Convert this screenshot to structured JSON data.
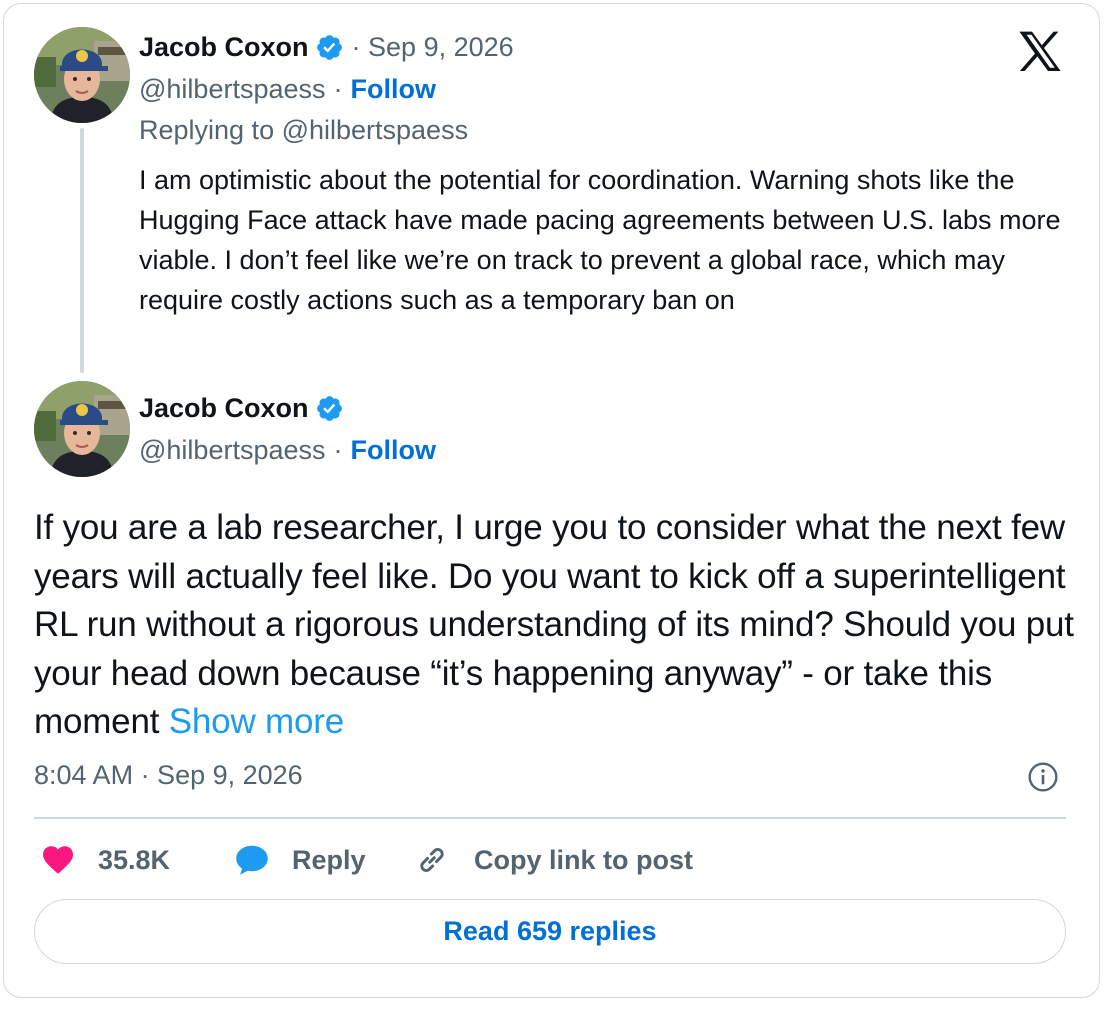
{
  "reply_tweet": {
    "author_name": "Jacob Coxon",
    "date": "· Sep 9, 2026",
    "handle": "@hilbertspaess",
    "separator": "·",
    "follow_label": "Follow",
    "replying_to": "Replying to @hilbertspaess",
    "text": "I am optimistic about the potential for coordination. Warning shots like the Hugging Face attack have made pacing agreements between U.S. labs more viable. I don’t feel like we’re on track to prevent a global race, which may require costly actions such as a temporary ban on"
  },
  "main_tweet": {
    "author_name": "Jacob Coxon",
    "handle": "@hilbertspaess",
    "separator": "·",
    "follow_label": "Follow",
    "text": "If you are a lab researcher, I urge you to consider what the next few years will actually feel like. Do you want to kick off a superintelligent RL run without a rigorous understanding of its mind? Should you put your head down because “it’s happening anyway” - or take this moment ",
    "show_more_label": "Show more",
    "timestamp": "8:04 AM · Sep 9, 2026"
  },
  "actions": {
    "like_count": "35.8K",
    "reply_label": "Reply",
    "copy_link_label": "Copy link to post"
  },
  "read_replies_label": "Read 659 replies",
  "icons": {
    "logo": "x-logo-icon",
    "verified": "verified-badge-icon",
    "info": "info-icon",
    "like": "heart-icon",
    "reply": "speech-bubble-icon",
    "copy_link": "link-icon"
  },
  "colors": {
    "text_primary": "#0f1419",
    "text_secondary": "#536471",
    "link_blue": "#006fd6",
    "show_more_blue": "#1d9bf0",
    "verified_blue": "#1d9bf0",
    "heart_pink": "#f91880",
    "border": "#cfd9de"
  }
}
